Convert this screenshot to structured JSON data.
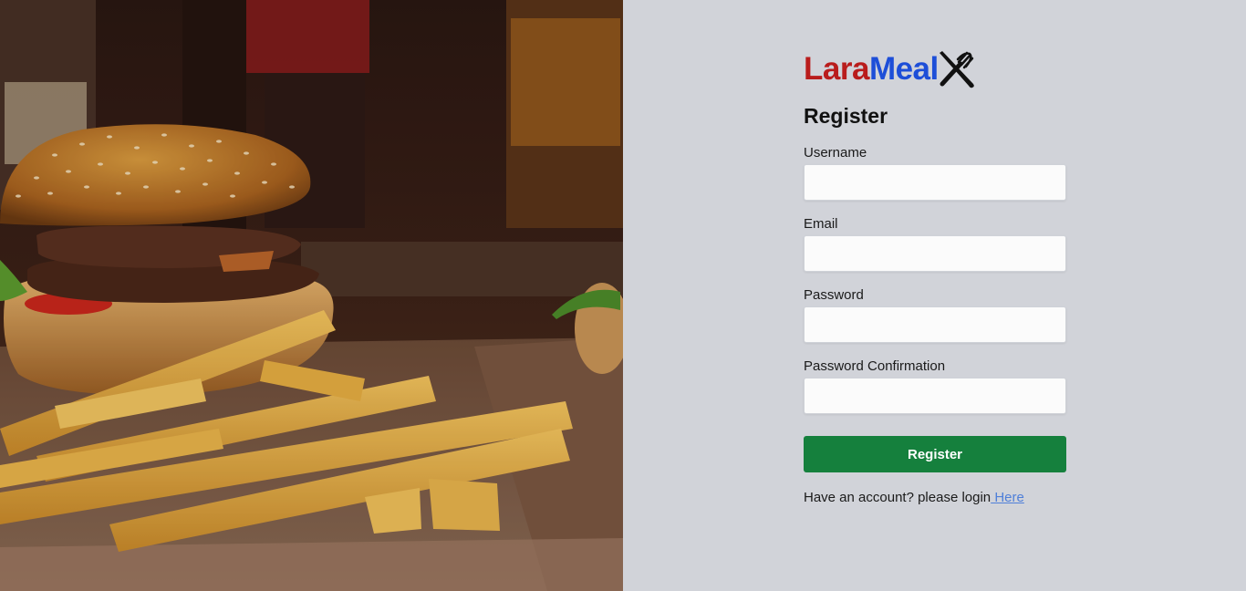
{
  "brand": {
    "part1": "Lara",
    "part2": "Meal",
    "icon": "fork-knife-icon"
  },
  "form": {
    "title": "Register",
    "fields": [
      {
        "label": "Username",
        "value": "",
        "placeholder": ""
      },
      {
        "label": "Email",
        "value": "",
        "placeholder": ""
      },
      {
        "label": "Password",
        "value": "",
        "placeholder": ""
      },
      {
        "label": "Password Confirmation",
        "value": "",
        "placeholder": ""
      }
    ],
    "submit_label": "Register",
    "login_prompt": "Have an account? please login",
    "login_link": " Here"
  },
  "colors": {
    "brand_red": "#b91c1c",
    "brand_blue": "#1d4ed8",
    "submit_green": "#15803d",
    "panel_bg": "#d1d3d9",
    "link": "#4f7fd9"
  },
  "hero_image": {
    "subject": "burger-and-fries-photo"
  }
}
